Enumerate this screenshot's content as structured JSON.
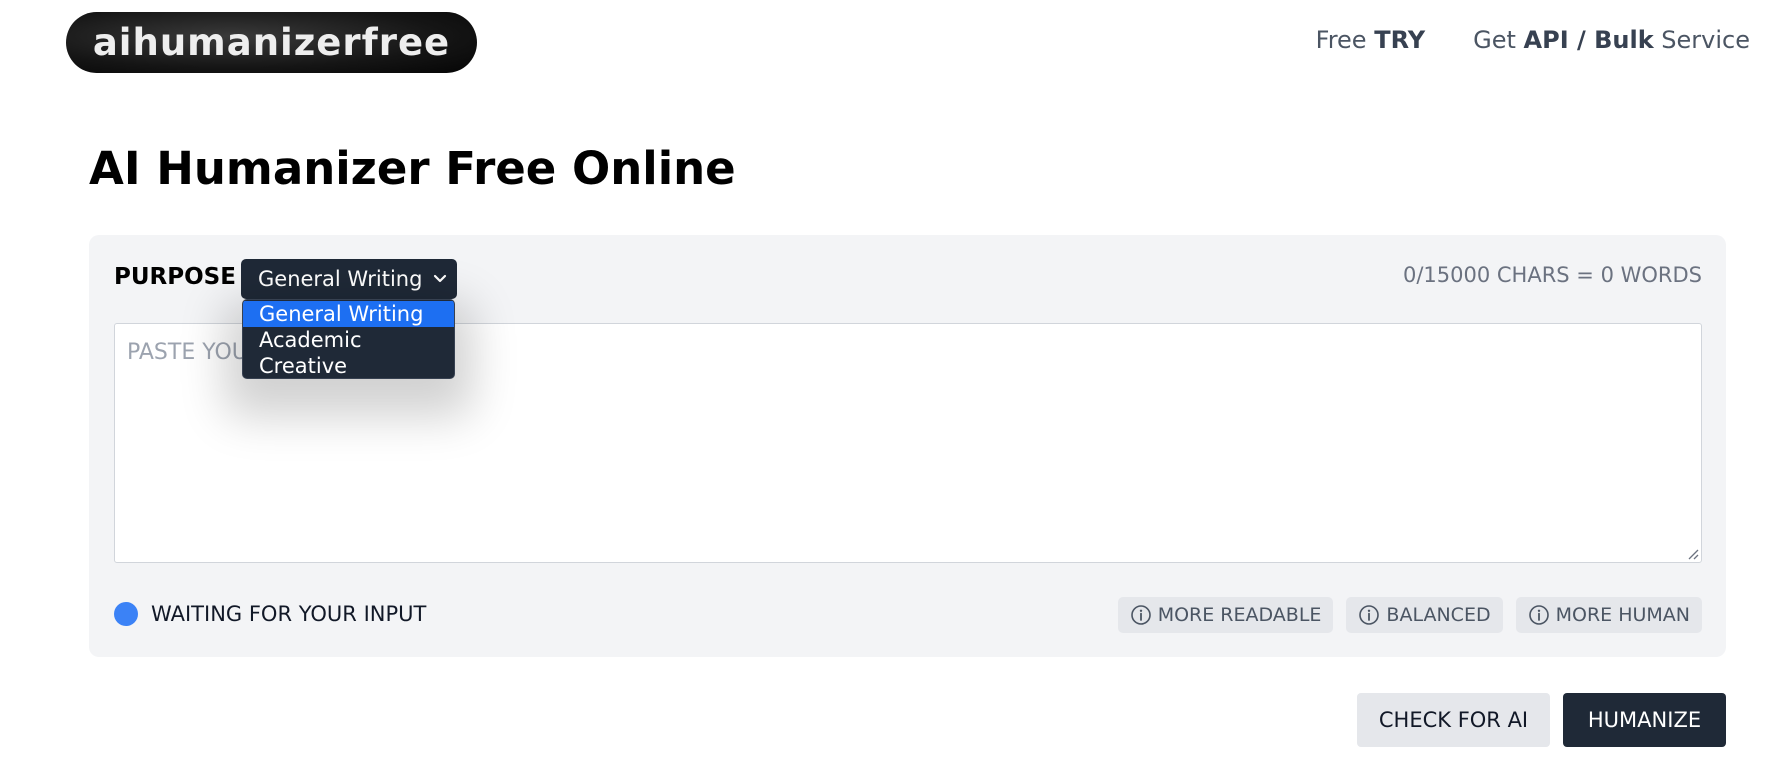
{
  "header": {
    "logo_text": "aihumanizerfree",
    "nav": {
      "free_try_prefix": "Free ",
      "free_try_bold": "TRY",
      "api_prefix": "Get ",
      "api_bold": "API / Bulk",
      "api_suffix": " Service"
    }
  },
  "page": {
    "title": "AI Humanizer Free Online"
  },
  "editor": {
    "purpose_label": "PURPOSE",
    "purpose_selected": "General Writing",
    "purpose_options": [
      "General Writing",
      "Academic",
      "Creative"
    ],
    "char_count": "0/15000 CHARS = 0 WORDS",
    "textarea_placeholder": "PASTE YOUR TEXT HERE",
    "status_text": "WAITING FOR YOUR INPUT",
    "modes": [
      "MORE READABLE",
      "BALANCED",
      "MORE HUMAN"
    ]
  },
  "actions": {
    "check_label": "CHECK FOR AI",
    "humanize_label": "HUMANIZE"
  },
  "colors": {
    "dark": "#1f2937",
    "panel_bg": "#f3f4f6",
    "status_dot": "#3b82f6",
    "selected_option": "#1d6ff2"
  }
}
